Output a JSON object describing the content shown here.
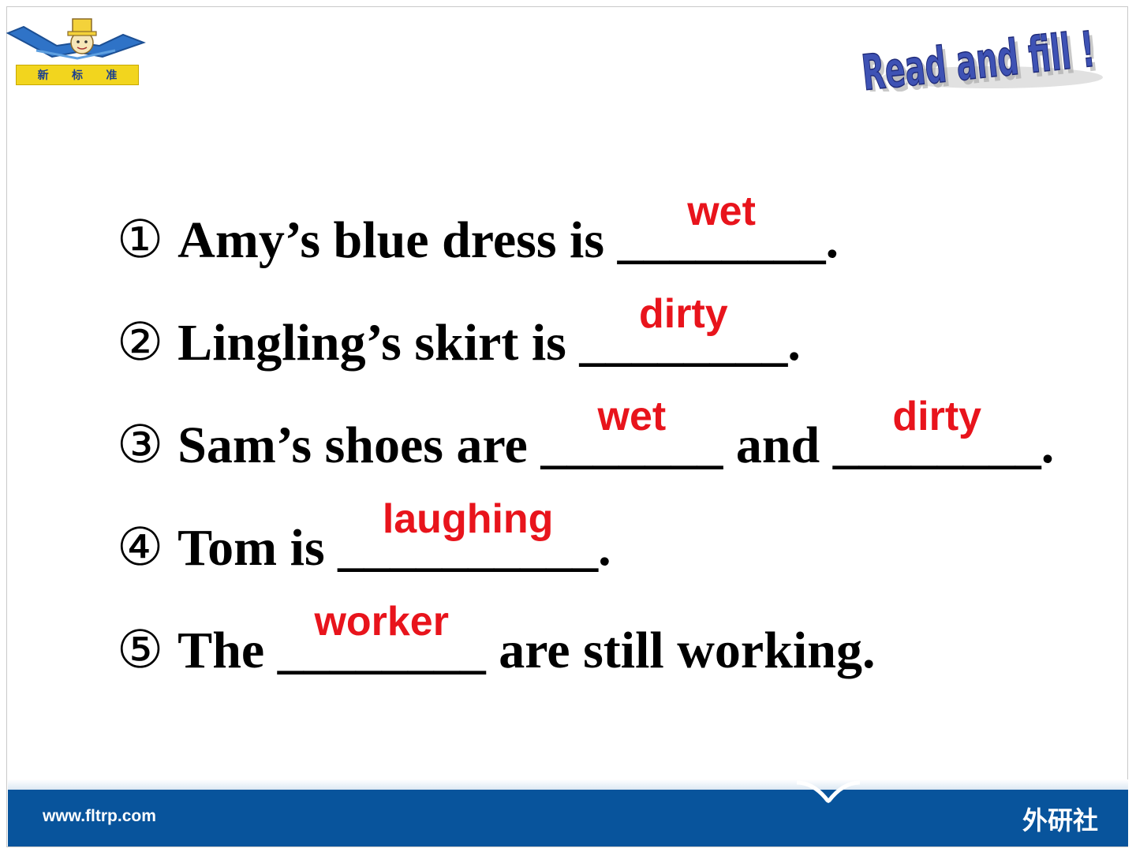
{
  "logo": {
    "chars": [
      "新",
      "标",
      "准"
    ]
  },
  "title": "Read and fill !",
  "questions": [
    {
      "num": "①",
      "before": "Amy’s blue dress is ",
      "blank": "________",
      "answer": "wet",
      "after": "."
    },
    {
      "num": "②",
      "before": "Lingling’s skirt is ",
      "blank": "________",
      "answer": "dirty",
      "after": "."
    },
    {
      "num": "③",
      "before": "Sam’s shoes are ",
      "blank": "_______",
      "answer": "wet",
      "middle": " and ",
      "blank2": "________",
      "answer2": "dirty",
      "after": "."
    },
    {
      "num": "④",
      "before": "Tom is ",
      "blank": "__________",
      "answer": "laughing",
      "after": "."
    },
    {
      "num": "⑤",
      "before": "The ",
      "blank": "________",
      "answer": "worker",
      "after": " are still working."
    }
  ],
  "footer": {
    "url": "www.fltrp.com",
    "brand": "外研社"
  },
  "colors": {
    "answer": "#e8141c",
    "footer": "#08549c",
    "title": "#3e52b4"
  }
}
